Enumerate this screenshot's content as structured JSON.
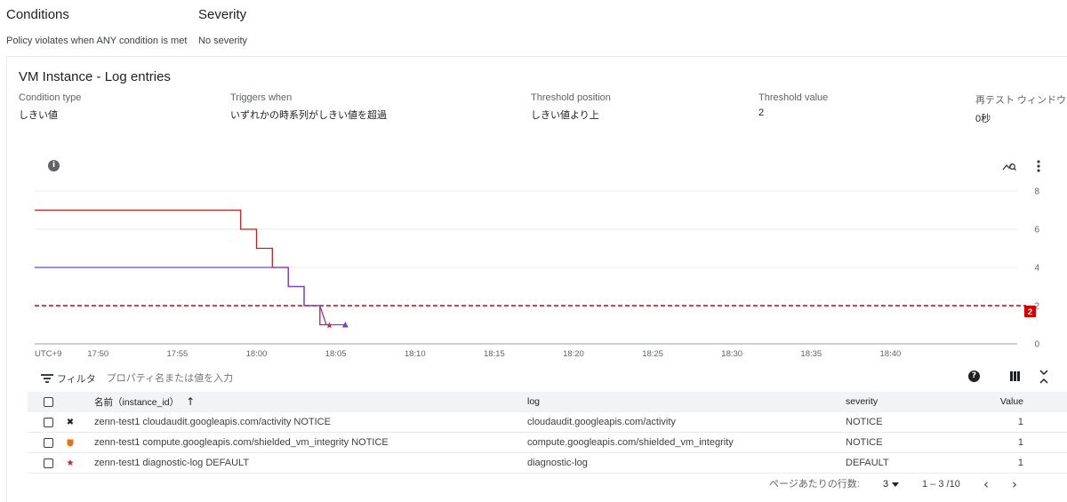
{
  "conditions": {
    "title": "Conditions",
    "subtitle": "Policy violates when ANY condition is met"
  },
  "severity": {
    "title": "Severity",
    "subtitle": "No severity"
  },
  "condition_card": {
    "title": "VM Instance - Log entries",
    "meta": [
      {
        "label": "Condition type",
        "value": "しきい値"
      },
      {
        "label": "Triggers when",
        "value": "いずれかの時系列がしきい値を超過"
      },
      {
        "label": "Threshold position",
        "value": "しきい値より上"
      },
      {
        "label": "Threshold value",
        "value": "2"
      },
      {
        "label": "再テスト ウィンドウ",
        "value": "0秒"
      }
    ]
  },
  "icons": {
    "info": "info-icon",
    "explore": "explore-chart-icon",
    "more": "more-vert-icon",
    "filter": "filter-icon",
    "help": "help-icon",
    "columns": "column-display-icon",
    "collapse": "collapse-icon"
  },
  "colors": {
    "threshold": "#d50000",
    "series_red": "#c5221f",
    "series_purple": "#7b3fcf",
    "series_orange": "#e8710a"
  },
  "chart_data": {
    "type": "line",
    "timezone_label": "UTC+9",
    "x_ticks": [
      "17:50",
      "17:55",
      "18:00",
      "18:05",
      "18:10",
      "18:15",
      "18:20",
      "18:25",
      "18:30",
      "18:35",
      "18:40"
    ],
    "y_ticks": [
      0,
      2,
      4,
      6,
      8
    ],
    "ylim": [
      0,
      8
    ],
    "xlim": [
      "17:46",
      "18:48"
    ],
    "threshold": {
      "value": 2,
      "label": "2"
    },
    "series": [
      {
        "key": "red",
        "marker": "star",
        "points": [
          [
            "17:46",
            7
          ],
          [
            "17:53",
            7
          ],
          [
            "17:59",
            7
          ],
          [
            "17:59",
            6
          ],
          [
            "18:00",
            6
          ],
          [
            "18:00",
            5
          ],
          [
            "18:01",
            5
          ],
          [
            "18:01",
            4
          ],
          [
            "18:02",
            4
          ],
          [
            "18:02",
            3
          ],
          [
            "18:03",
            3
          ],
          [
            "18:03",
            2
          ],
          [
            "18:04",
            2
          ],
          [
            "18:04",
            1
          ],
          [
            "18:04.6",
            1
          ]
        ]
      },
      {
        "key": "purple",
        "marker": "triangle",
        "points": [
          [
            "17:46",
            4
          ],
          [
            "17:55",
            4
          ],
          [
            "18:02",
            4
          ],
          [
            "18:02",
            3
          ],
          [
            "18:03",
            3
          ],
          [
            "18:03",
            2
          ],
          [
            "18:04",
            2
          ],
          [
            "18:04.4",
            1
          ],
          [
            "18:05.6",
            1
          ]
        ]
      }
    ]
  },
  "table": {
    "filter_label": "フィルタ",
    "filter_placeholder": "プロパティ名または値を入力",
    "columns": [
      "名前（instance_id）",
      "log",
      "severity",
      "Value"
    ],
    "rows": [
      {
        "icon": "x-mark-icon",
        "name": "zenn-test1 cloudaudit.googleapis.com/activity NOTICE",
        "log": "cloudaudit.googleapis.com/activity",
        "severity": "NOTICE",
        "value": "1"
      },
      {
        "icon": "shield-icon",
        "name": "zenn-test1 compute.googleapis.com/shielded_vm_integrity NOTICE",
        "log": "compute.googleapis.com/shielded_vm_integrity",
        "severity": "NOTICE",
        "value": "1"
      },
      {
        "icon": "star-icon",
        "name": "zenn-test1 diagnostic-log DEFAULT",
        "log": "diagnostic-log",
        "severity": "DEFAULT",
        "value": "1"
      }
    ],
    "pagination": {
      "rows_per_page_label": "ページあたりの行数:",
      "rows_per_page_value": "3",
      "range": "1 – 3 /10"
    }
  }
}
